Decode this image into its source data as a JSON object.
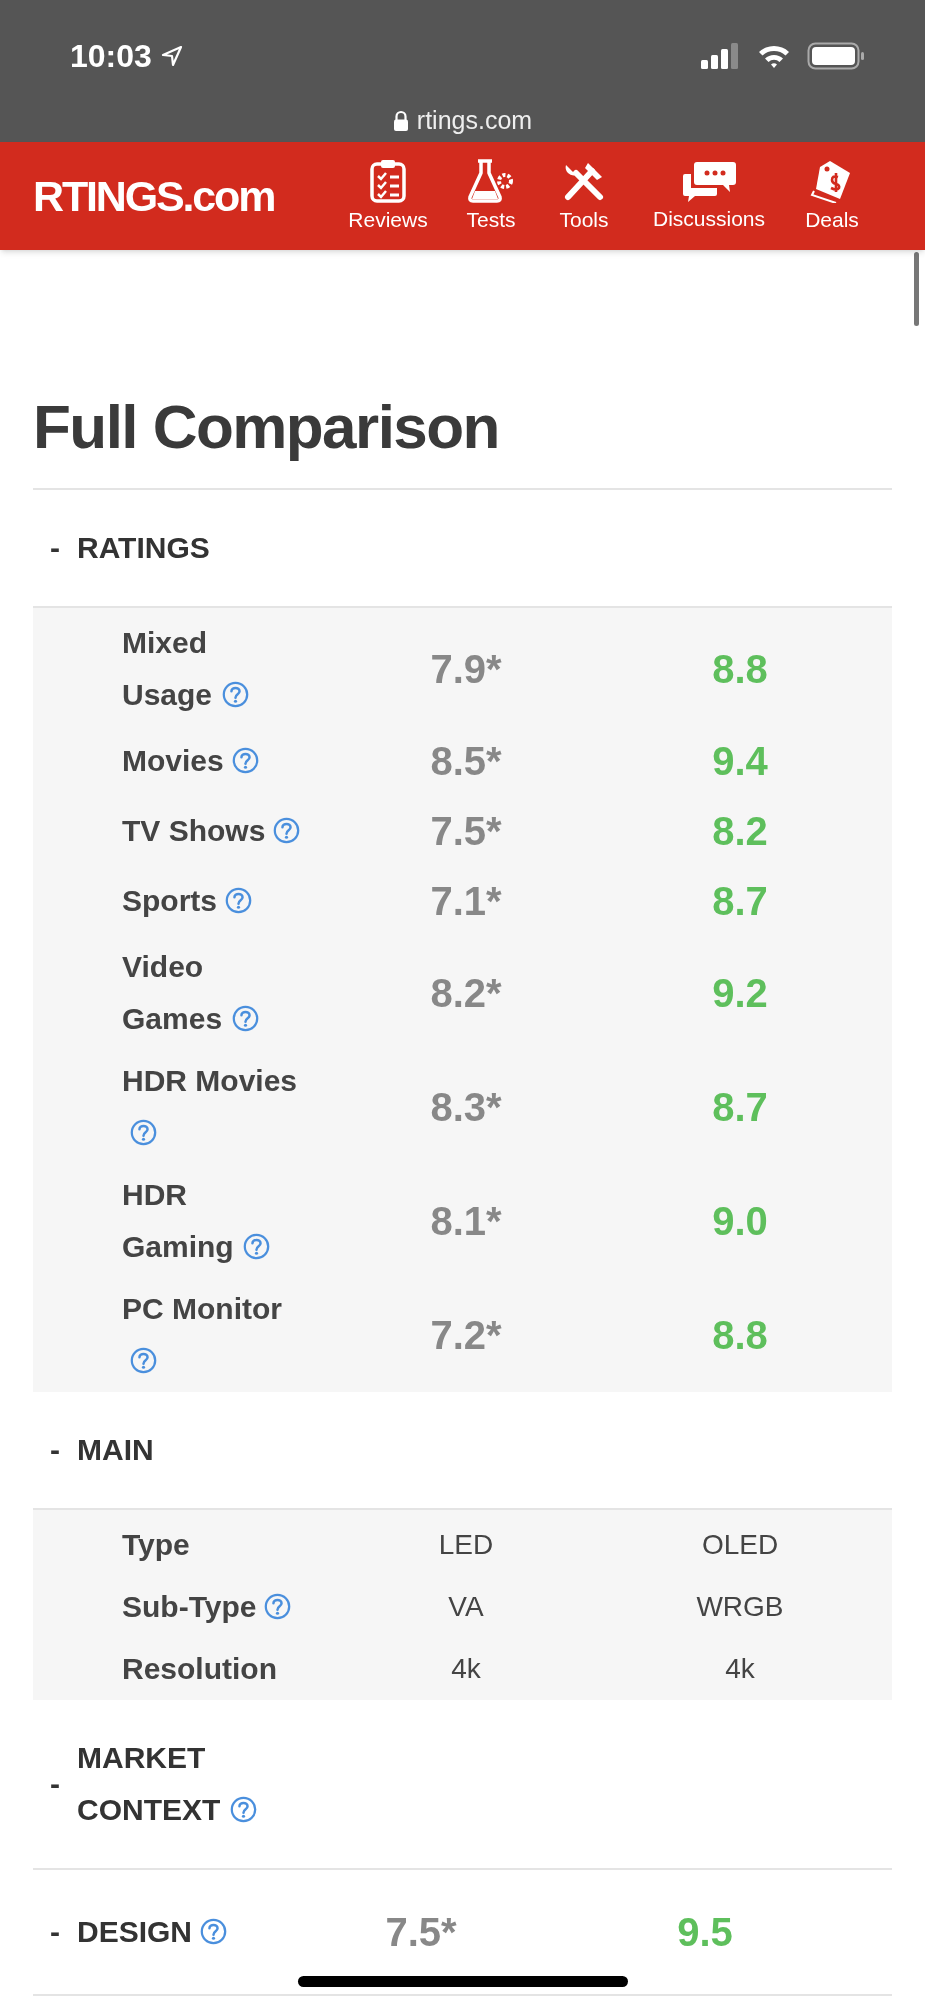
{
  "status_bar": {
    "time": "10:03",
    "url": "rtings.com"
  },
  "nav": {
    "logo": "RTINGS.com",
    "items": [
      {
        "label": "Reviews"
      },
      {
        "label": "Tests"
      },
      {
        "label": "Tools"
      },
      {
        "label": "Discussions"
      },
      {
        "label": "Deals"
      }
    ]
  },
  "heading": "Full Comparison",
  "sections": [
    {
      "toggle": "-",
      "title": "RATINGS",
      "help": false,
      "kind": "scores",
      "rows": [
        {
          "label": "Mixed Usage",
          "help": true,
          "values": [
            {
              "text": "7.9*",
              "best": false
            },
            {
              "text": "8.8",
              "best": true
            }
          ]
        },
        {
          "label": "Movies",
          "help": true,
          "values": [
            {
              "text": "8.5*",
              "best": false
            },
            {
              "text": "9.4",
              "best": true
            }
          ]
        },
        {
          "label": "TV Shows",
          "help": true,
          "values": [
            {
              "text": "7.5*",
              "best": false
            },
            {
              "text": "8.2",
              "best": true
            }
          ]
        },
        {
          "label": "Sports",
          "help": true,
          "values": [
            {
              "text": "7.1*",
              "best": false
            },
            {
              "text": "8.7",
              "best": true
            }
          ]
        },
        {
          "label": "Video Games",
          "help": true,
          "values": [
            {
              "text": "8.2*",
              "best": false
            },
            {
              "text": "9.2",
              "best": true
            }
          ]
        },
        {
          "label": "HDR Movies",
          "help": true,
          "values": [
            {
              "text": "8.3*",
              "best": false
            },
            {
              "text": "8.7",
              "best": true
            }
          ]
        },
        {
          "label": "HDR Gaming",
          "help": true,
          "values": [
            {
              "text": "8.1*",
              "best": false
            },
            {
              "text": "9.0",
              "best": true
            }
          ]
        },
        {
          "label": "PC Monitor",
          "help": true,
          "values": [
            {
              "text": "7.2*",
              "best": false
            },
            {
              "text": "8.8",
              "best": true
            }
          ]
        }
      ]
    },
    {
      "toggle": "-",
      "title": "MAIN",
      "help": false,
      "kind": "specs",
      "rows": [
        {
          "label": "Type",
          "help": false,
          "values": [
            {
              "text": "LED",
              "best": false
            },
            {
              "text": "OLED",
              "best": false
            }
          ]
        },
        {
          "label": "Sub-Type",
          "help": true,
          "values": [
            {
              "text": "VA",
              "best": false
            },
            {
              "text": "WRGB",
              "best": false
            }
          ]
        },
        {
          "label": "Resolution",
          "help": false,
          "values": [
            {
              "text": "4k",
              "best": false
            },
            {
              "text": "4k",
              "best": false
            }
          ]
        }
      ]
    },
    {
      "toggle": "-",
      "title": "MARKET CONTEXT",
      "help": true
    },
    {
      "toggle": "-",
      "title": "DESIGN",
      "help": true,
      "kind": "scores",
      "scores": [
        {
          "text": "7.5*",
          "best": false
        },
        {
          "text": "9.5",
          "best": true
        }
      ]
    }
  ]
}
